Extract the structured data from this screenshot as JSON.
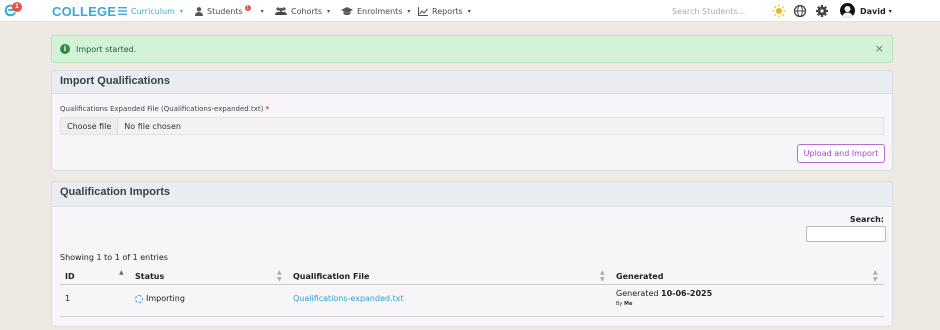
{
  "nav": {
    "logo_badge": "1",
    "brand": "COLLEGE",
    "items": [
      {
        "label": "Curriculum",
        "icon": "menu-icon",
        "active": true
      },
      {
        "label": "Students",
        "icon": "user-icon",
        "badge": "1"
      },
      {
        "label": "Cohorts",
        "icon": "group-icon"
      },
      {
        "label": "Enrolments",
        "icon": "graduation-cap-icon"
      },
      {
        "label": "Reports",
        "icon": "chart-icon"
      }
    ],
    "search_placeholder": "Search Students...",
    "user_name": "David"
  },
  "alert": {
    "text": "Import started.",
    "close": "×"
  },
  "import_card": {
    "title": "Import Qualifications",
    "field_label": "Qualifications Expanded File (Qualifications-expanded.txt)",
    "required_mark": "*",
    "choose_file": "Choose file",
    "no_file": "No file chosen",
    "upload_button": "Upload and Import"
  },
  "imports_card": {
    "title": "Qualification Imports",
    "search_label": "Search:",
    "entries_text": "Showing 1 to 1 of 1 entries",
    "columns": [
      "ID",
      "Status",
      "Qualification File",
      "Generated"
    ],
    "rows": [
      {
        "id": "1",
        "status": "Importing",
        "file": "Qualifications-expanded.txt",
        "generated_prefix": "Generated",
        "generated_date": "10-06-2025",
        "by_prefix": "By",
        "by_user": "Me"
      }
    ]
  },
  "colors": {
    "brand": "#38a9d8",
    "alert_bg": "#d3f2d8",
    "upload_accent": "#a049c7",
    "link": "#2aa0d6"
  }
}
